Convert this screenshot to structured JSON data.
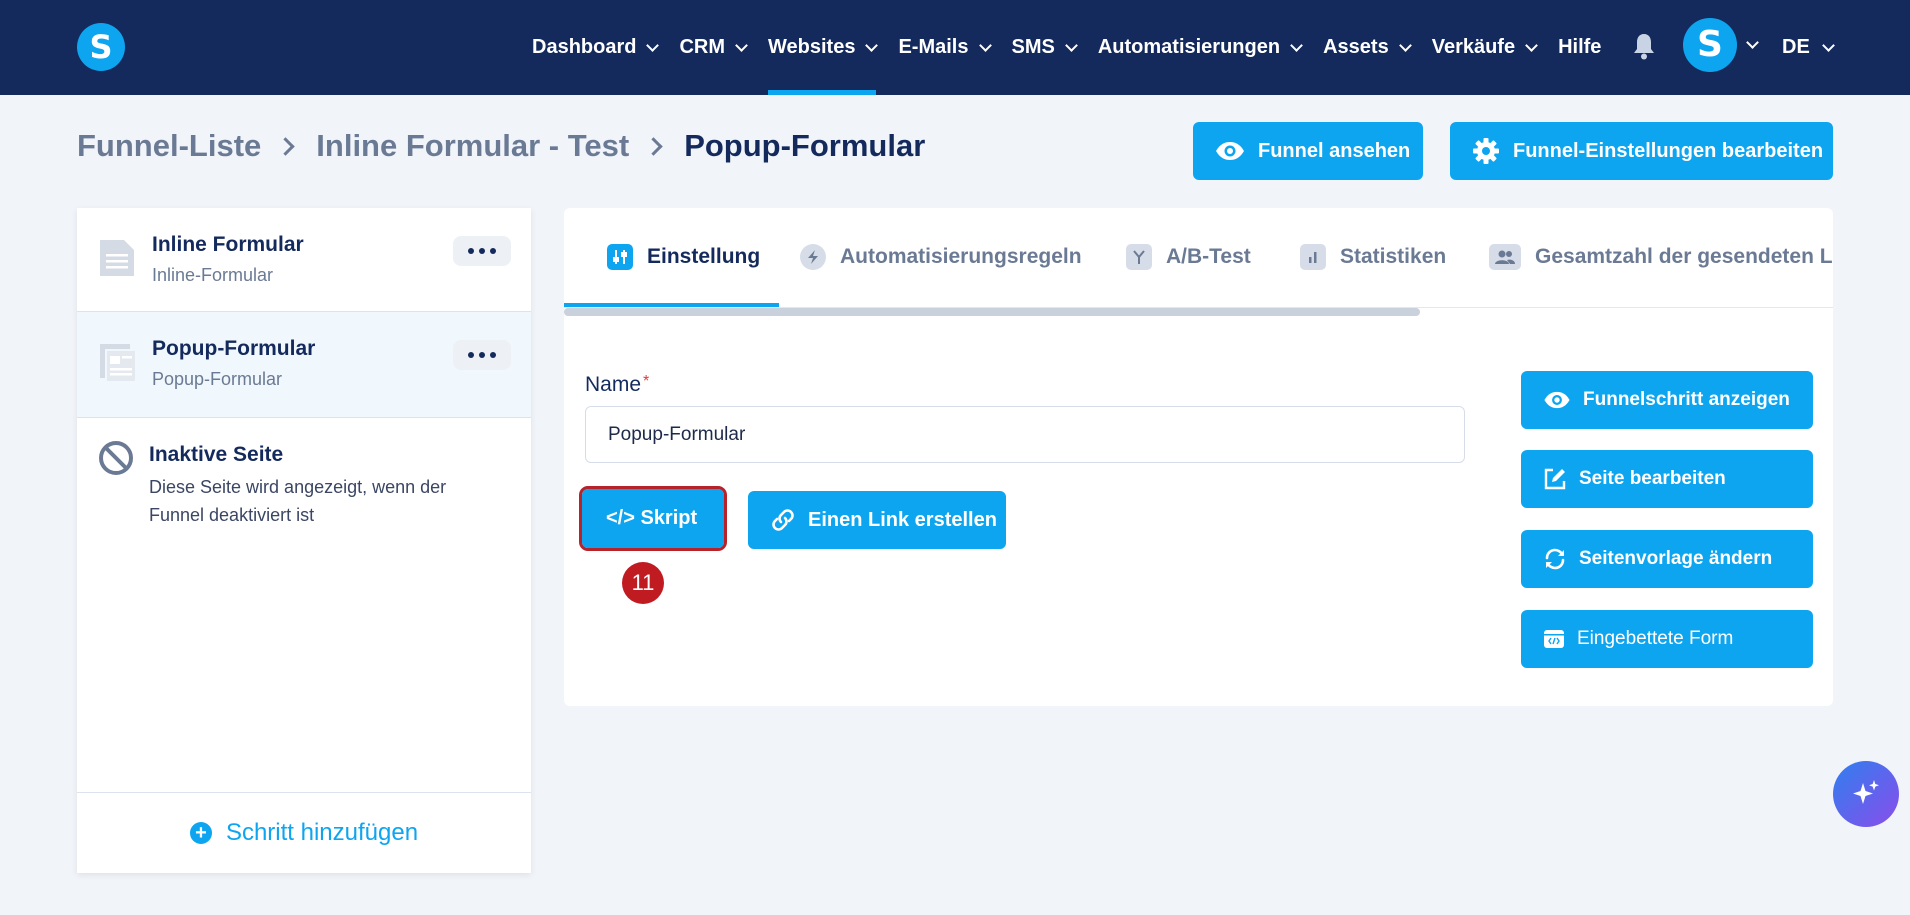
{
  "logo": "S",
  "nav": {
    "items": [
      {
        "label": "Dashboard",
        "chevron": true,
        "active": false
      },
      {
        "label": "CRM",
        "chevron": true,
        "active": false
      },
      {
        "label": "Websites",
        "chevron": true,
        "active": true
      },
      {
        "label": "E-Mails",
        "chevron": true,
        "active": false
      },
      {
        "label": "SMS",
        "chevron": true,
        "active": false
      },
      {
        "label": "Automatisierungen",
        "chevron": true,
        "active": false
      },
      {
        "label": "Assets",
        "chevron": true,
        "active": false
      },
      {
        "label": "Verkäufe",
        "chevron": true,
        "active": false
      },
      {
        "label": "Hilfe",
        "chevron": false,
        "active": false
      }
    ],
    "avatar_letter": "S",
    "language": "DE"
  },
  "breadcrumb": {
    "items": [
      "Funnel-Liste",
      "Inline Formular - Test",
      "Popup-Formular"
    ]
  },
  "header_buttons": {
    "view_funnel": "Funnel ansehen",
    "edit_funnel_settings": "Funnel-Einstellungen bearbeiten"
  },
  "sidebar": {
    "steps": [
      {
        "title": "Inline Formular",
        "subtitle": "Inline-Formular"
      },
      {
        "title": "Popup-Formular",
        "subtitle": "Popup-Formular"
      }
    ],
    "inactive": {
      "title": "Inaktive Seite",
      "description": "Diese Seite wird angezeigt, wenn der Funnel deaktiviert ist"
    },
    "add_step": "Schritt hinzufügen"
  },
  "tabs": [
    {
      "label": "Einstellung"
    },
    {
      "label": "Automatisierungsregeln"
    },
    {
      "label": "A/B-Test"
    },
    {
      "label": "Statistiken"
    },
    {
      "label": "Gesamtzahl der gesendeten L"
    }
  ],
  "form": {
    "name_label": "Name",
    "required_mark": "*",
    "name_value": "Popup-Formular"
  },
  "actions": {
    "skript": "</> Skript",
    "create_link": "Einen Link erstellen",
    "step_badge": "11"
  },
  "side_actions": {
    "show_step": "Funnelschritt anzeigen",
    "edit_page": "Seite bearbeiten",
    "change_template": "Seitenvorlage ändern",
    "embedded_form": "Eingebettete Form"
  },
  "colors": {
    "nav_bg": "#142a5c",
    "accent": "#0ea5f0",
    "badge": "#c11b22"
  }
}
